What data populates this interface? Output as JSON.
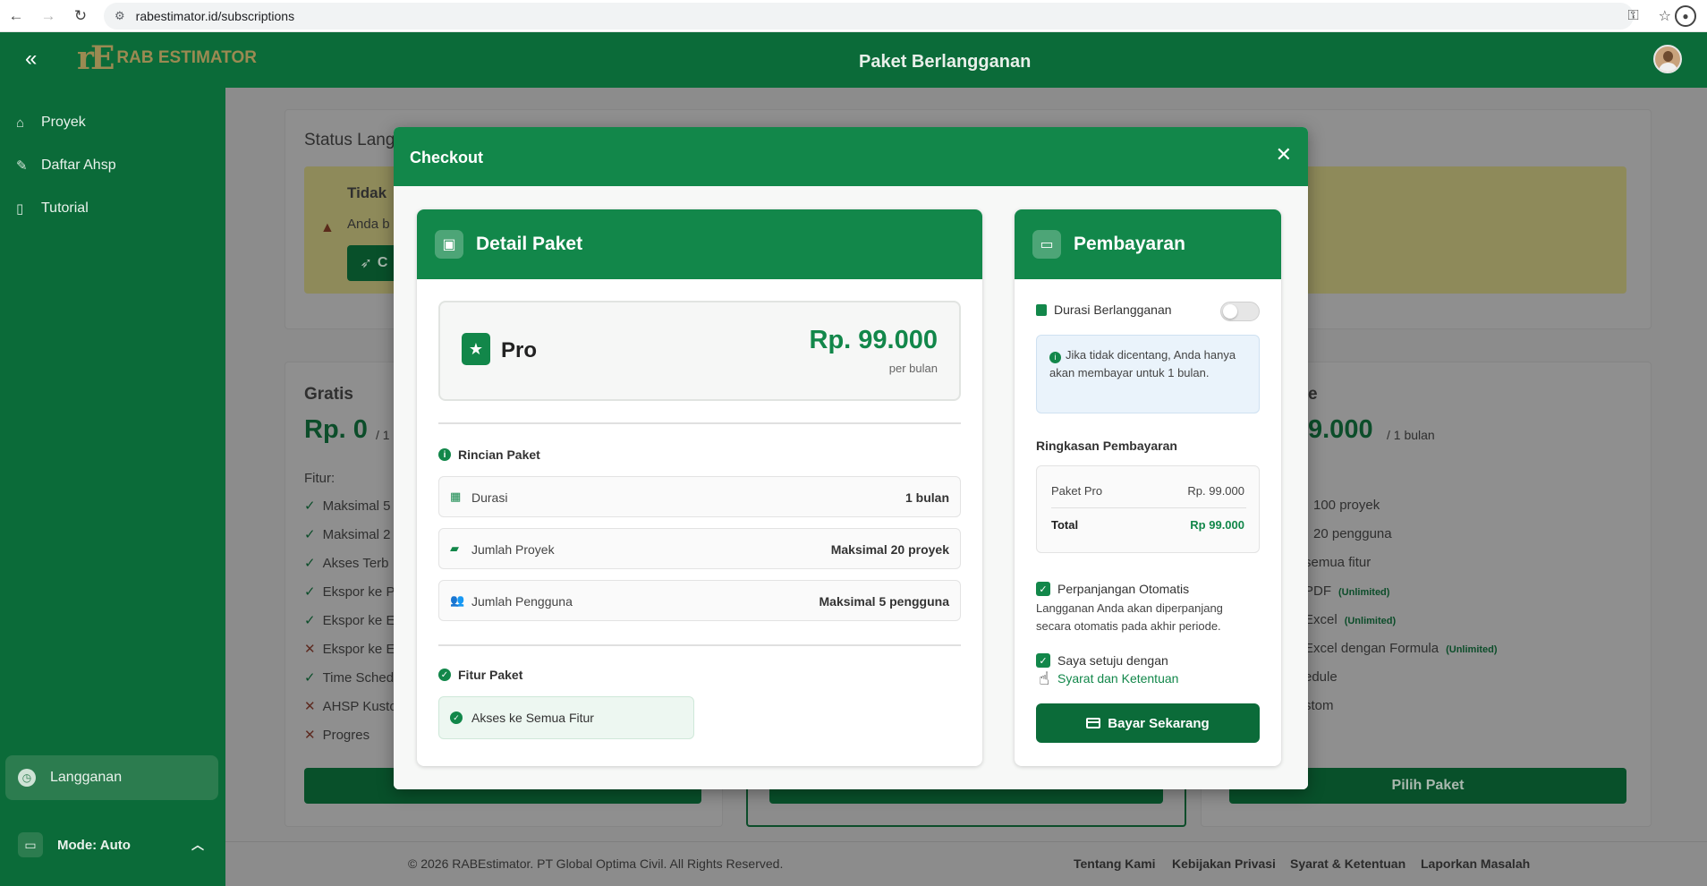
{
  "browser": {
    "url": "rabestimator.id/subscriptions"
  },
  "header": {
    "logo_text": "RAB ESTIMATOR",
    "title": "Paket Berlangganan"
  },
  "sidebar": {
    "items": [
      {
        "label": "Proyek",
        "icon": "home-icon"
      },
      {
        "label": "Daftar Ahsp",
        "icon": "edit-icon"
      },
      {
        "label": "Tutorial",
        "icon": "book-icon"
      }
    ],
    "subscription_label": "Langganan",
    "mode_label": "Mode: Auto"
  },
  "background": {
    "status_title": "Status Lang",
    "warn_title": "Tidak",
    "warn_text": "Anda b",
    "warn_btn": "C",
    "free": {
      "name": "Gratis",
      "price": "Rp. 0",
      "per": "/ 1",
      "features_label": "Fitur:",
      "features": [
        {
          "mark": "check",
          "text": "Maksimal 5"
        },
        {
          "mark": "check",
          "text": "Maksimal 2"
        },
        {
          "mark": "check",
          "text": "Akses Terb"
        },
        {
          "mark": "check",
          "text": "Ekspor ke P"
        },
        {
          "mark": "check",
          "text": "Ekspor ke E"
        },
        {
          "mark": "cross",
          "text": "Ekspor ke E"
        },
        {
          "mark": "check",
          "text": "Time Sched"
        },
        {
          "mark": "cross",
          "text": "AHSP Kusto"
        },
        {
          "mark": "cross",
          "text": "Progres"
        }
      ]
    },
    "pro_right": {
      "name_tail": "e",
      "price_tail": "9.000",
      "per": "/ 1 bulan",
      "features": [
        "100 proyek",
        "20 pengguna",
        "semua fitur",
        "PDF",
        "Excel",
        "Excel dengan Formula",
        "edule",
        "stom"
      ],
      "badge": "(Unlimited)",
      "button": "Pilih Paket"
    },
    "footer": {
      "copyright": "© 2026 RABEstimator. PT Global Optima Civil. All Rights Reserved.",
      "links": [
        "Tentang Kami",
        "Kebijakan Privasi",
        "Syarat & Ketentuan",
        "Laporkan Masalah"
      ]
    }
  },
  "modal": {
    "title": "Checkout",
    "detail": {
      "title": "Detail Paket",
      "plan_name": "Pro",
      "plan_price": "Rp. 99.000",
      "plan_period": "per bulan",
      "breakdown_label": "Rincian Paket",
      "rows": [
        {
          "icon": "calendar-icon",
          "label": "Durasi",
          "value": "1 bulan"
        },
        {
          "icon": "folder-icon",
          "label": "Jumlah Proyek",
          "value": "Maksimal 20 proyek"
        },
        {
          "icon": "users-icon",
          "label": "Jumlah Pengguna",
          "value": "Maksimal 5 pengguna"
        }
      ],
      "features_label": "Fitur Paket",
      "features": [
        "Akses ke Semua Fitur"
      ]
    },
    "payment": {
      "title": "Pembayaran",
      "duration_label": "Durasi Berlangganan",
      "duration_toggle_on": false,
      "info_text": "Jika tidak dicentang, Anda hanya akan membayar untuk 1 bulan.",
      "summary_title": "Ringkasan Pembayaran",
      "summary_item_label": "Paket Pro",
      "summary_item_value": "Rp. 99.000",
      "total_label": "Total",
      "total_value": "Rp 99.000",
      "auto_renew_label": "Perpanjangan Otomatis",
      "auto_renew_checked": true,
      "auto_renew_text": "Langganan Anda akan diperpanjang secara otomatis pada akhir periode.",
      "agree_label": "Saya setuju dengan",
      "agree_link": "Syarat dan Ketentuan",
      "agree_checked": true,
      "pay_button": "Bayar Sekarang"
    }
  },
  "colors": {
    "brand_dark": "#0b6b39",
    "brand": "#12874a",
    "logo_gold": "#9b8a52"
  }
}
